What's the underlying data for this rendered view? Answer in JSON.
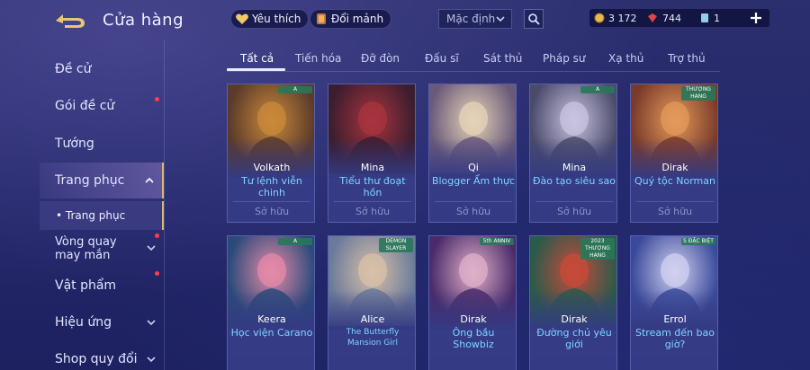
{
  "header": {
    "title": "Cửa hàng",
    "favorite_label": "Yêu thích",
    "exchange_label": "Đổi mảnh",
    "sort_value": "Mặc định"
  },
  "currencies": {
    "gold": "3 172",
    "gems": "744",
    "vouchers": "1"
  },
  "sidebar": {
    "items": [
      {
        "label": "Đề cử",
        "dot": false
      },
      {
        "label": "Gói đề cử",
        "dot": true
      },
      {
        "label": "Tướng",
        "dot": false
      },
      {
        "label": "Trang phục",
        "dot": false
      },
      {
        "label": "Vòng quay may mắn",
        "dot": true
      },
      {
        "label": "Vật phẩm",
        "dot": true
      },
      {
        "label": "Hiệu ứng",
        "dot": false
      },
      {
        "label": "Shop quy đổi",
        "dot": false
      }
    ],
    "sub_item": "• Trang phục"
  },
  "tabs": [
    "Tất cả",
    "Tiến hóa",
    "Đỡ đòn",
    "Đấu sĩ",
    "Sát thủ",
    "Pháp sư",
    "Xạ thủ",
    "Trợ thủ"
  ],
  "cards": [
    {
      "hero": "Volkath",
      "skin": "Tư lệnh viễn chinh",
      "status": "Sở hữu",
      "badge": "A",
      "colors": [
        "#5a3a2a",
        "#c9893a"
      ]
    },
    {
      "hero": "Mina",
      "skin": "Tiểu thư đoạt hồn",
      "status": "Sở hữu",
      "badge": "",
      "colors": [
        "#3a1d2e",
        "#a8343e"
      ]
    },
    {
      "hero": "Qi",
      "skin": "Blogger Ẩm thực",
      "status": "Sở hữu",
      "badge": "",
      "colors": [
        "#6a5a7a",
        "#e6d3b8"
      ]
    },
    {
      "hero": "Mina",
      "skin": "Đào tạo siêu sao",
      "status": "Sở hữu",
      "badge": "A",
      "colors": [
        "#4a4a6a",
        "#c9c4e0"
      ]
    },
    {
      "hero": "Dirak",
      "skin": "Quý tộc Norman",
      "status": "Sở hữu",
      "badge": "THƯỢNG HẠNG",
      "colors": [
        "#7a3a2a",
        "#e39a5a"
      ]
    },
    {
      "hero": "Keera",
      "skin": "Học viện Carano",
      "status": "",
      "badge": "A",
      "colors": [
        "#2a4a7a",
        "#e68aa8"
      ]
    },
    {
      "hero": "Alice",
      "skin": "The Butterfly Mansion Girl",
      "status": "",
      "badge": "DEMON SLAYER",
      "colors": [
        "#6a7a9a",
        "#d8c0a8"
      ]
    },
    {
      "hero": "Dirak",
      "skin": "Ông bầu Showbiz",
      "status": "",
      "badge": "5th ANNIV",
      "colors": [
        "#4a2a6a",
        "#e0b0c8"
      ]
    },
    {
      "hero": "Dirak",
      "skin": "Đường chủ yêu giới",
      "status": "",
      "badge": "2023 THƯỢNG HẠNG",
      "colors": [
        "#2a5a4a",
        "#c84a3a"
      ]
    },
    {
      "hero": "Errol",
      "skin": "Stream đến bao giờ?",
      "status": "",
      "badge": "S ĐẶC BIỆT",
      "colors": [
        "#3a4a9a",
        "#d0d0f0"
      ]
    }
  ],
  "colors": {
    "accent_gold": "#d9b86a",
    "skin_name": "#7fd4ff",
    "red_dot": "#ff3b4f"
  }
}
